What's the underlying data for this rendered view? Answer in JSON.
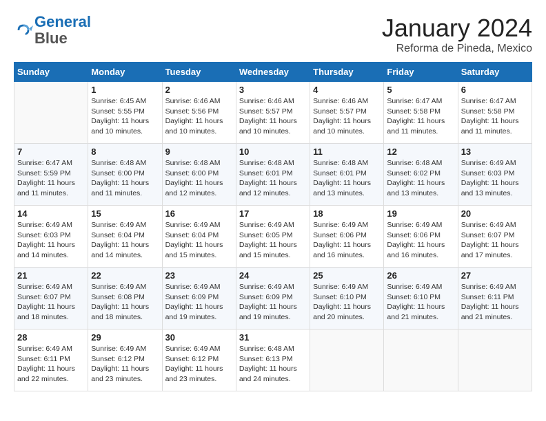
{
  "header": {
    "logo_line1": "General",
    "logo_line2": "Blue",
    "month": "January 2024",
    "location": "Reforma de Pineda, Mexico"
  },
  "weekdays": [
    "Sunday",
    "Monday",
    "Tuesday",
    "Wednesday",
    "Thursday",
    "Friday",
    "Saturday"
  ],
  "weeks": [
    [
      {
        "num": "",
        "info": ""
      },
      {
        "num": "1",
        "info": "Sunrise: 6:45 AM\nSunset: 5:55 PM\nDaylight: 11 hours\nand 10 minutes."
      },
      {
        "num": "2",
        "info": "Sunrise: 6:46 AM\nSunset: 5:56 PM\nDaylight: 11 hours\nand 10 minutes."
      },
      {
        "num": "3",
        "info": "Sunrise: 6:46 AM\nSunset: 5:57 PM\nDaylight: 11 hours\nand 10 minutes."
      },
      {
        "num": "4",
        "info": "Sunrise: 6:46 AM\nSunset: 5:57 PM\nDaylight: 11 hours\nand 10 minutes."
      },
      {
        "num": "5",
        "info": "Sunrise: 6:47 AM\nSunset: 5:58 PM\nDaylight: 11 hours\nand 11 minutes."
      },
      {
        "num": "6",
        "info": "Sunrise: 6:47 AM\nSunset: 5:58 PM\nDaylight: 11 hours\nand 11 minutes."
      }
    ],
    [
      {
        "num": "7",
        "info": "Sunrise: 6:47 AM\nSunset: 5:59 PM\nDaylight: 11 hours\nand 11 minutes."
      },
      {
        "num": "8",
        "info": "Sunrise: 6:48 AM\nSunset: 6:00 PM\nDaylight: 11 hours\nand 11 minutes."
      },
      {
        "num": "9",
        "info": "Sunrise: 6:48 AM\nSunset: 6:00 PM\nDaylight: 11 hours\nand 12 minutes."
      },
      {
        "num": "10",
        "info": "Sunrise: 6:48 AM\nSunset: 6:01 PM\nDaylight: 11 hours\nand 12 minutes."
      },
      {
        "num": "11",
        "info": "Sunrise: 6:48 AM\nSunset: 6:01 PM\nDaylight: 11 hours\nand 13 minutes."
      },
      {
        "num": "12",
        "info": "Sunrise: 6:48 AM\nSunset: 6:02 PM\nDaylight: 11 hours\nand 13 minutes."
      },
      {
        "num": "13",
        "info": "Sunrise: 6:49 AM\nSunset: 6:03 PM\nDaylight: 11 hours\nand 13 minutes."
      }
    ],
    [
      {
        "num": "14",
        "info": "Sunrise: 6:49 AM\nSunset: 6:03 PM\nDaylight: 11 hours\nand 14 minutes."
      },
      {
        "num": "15",
        "info": "Sunrise: 6:49 AM\nSunset: 6:04 PM\nDaylight: 11 hours\nand 14 minutes."
      },
      {
        "num": "16",
        "info": "Sunrise: 6:49 AM\nSunset: 6:04 PM\nDaylight: 11 hours\nand 15 minutes."
      },
      {
        "num": "17",
        "info": "Sunrise: 6:49 AM\nSunset: 6:05 PM\nDaylight: 11 hours\nand 15 minutes."
      },
      {
        "num": "18",
        "info": "Sunrise: 6:49 AM\nSunset: 6:06 PM\nDaylight: 11 hours\nand 16 minutes."
      },
      {
        "num": "19",
        "info": "Sunrise: 6:49 AM\nSunset: 6:06 PM\nDaylight: 11 hours\nand 16 minutes."
      },
      {
        "num": "20",
        "info": "Sunrise: 6:49 AM\nSunset: 6:07 PM\nDaylight: 11 hours\nand 17 minutes."
      }
    ],
    [
      {
        "num": "21",
        "info": "Sunrise: 6:49 AM\nSunset: 6:07 PM\nDaylight: 11 hours\nand 18 minutes."
      },
      {
        "num": "22",
        "info": "Sunrise: 6:49 AM\nSunset: 6:08 PM\nDaylight: 11 hours\nand 18 minutes."
      },
      {
        "num": "23",
        "info": "Sunrise: 6:49 AM\nSunset: 6:09 PM\nDaylight: 11 hours\nand 19 minutes."
      },
      {
        "num": "24",
        "info": "Sunrise: 6:49 AM\nSunset: 6:09 PM\nDaylight: 11 hours\nand 19 minutes."
      },
      {
        "num": "25",
        "info": "Sunrise: 6:49 AM\nSunset: 6:10 PM\nDaylight: 11 hours\nand 20 minutes."
      },
      {
        "num": "26",
        "info": "Sunrise: 6:49 AM\nSunset: 6:10 PM\nDaylight: 11 hours\nand 21 minutes."
      },
      {
        "num": "27",
        "info": "Sunrise: 6:49 AM\nSunset: 6:11 PM\nDaylight: 11 hours\nand 21 minutes."
      }
    ],
    [
      {
        "num": "28",
        "info": "Sunrise: 6:49 AM\nSunset: 6:11 PM\nDaylight: 11 hours\nand 22 minutes."
      },
      {
        "num": "29",
        "info": "Sunrise: 6:49 AM\nSunset: 6:12 PM\nDaylight: 11 hours\nand 23 minutes."
      },
      {
        "num": "30",
        "info": "Sunrise: 6:49 AM\nSunset: 6:12 PM\nDaylight: 11 hours\nand 23 minutes."
      },
      {
        "num": "31",
        "info": "Sunrise: 6:48 AM\nSunset: 6:13 PM\nDaylight: 11 hours\nand 24 minutes."
      },
      {
        "num": "",
        "info": ""
      },
      {
        "num": "",
        "info": ""
      },
      {
        "num": "",
        "info": ""
      }
    ]
  ]
}
